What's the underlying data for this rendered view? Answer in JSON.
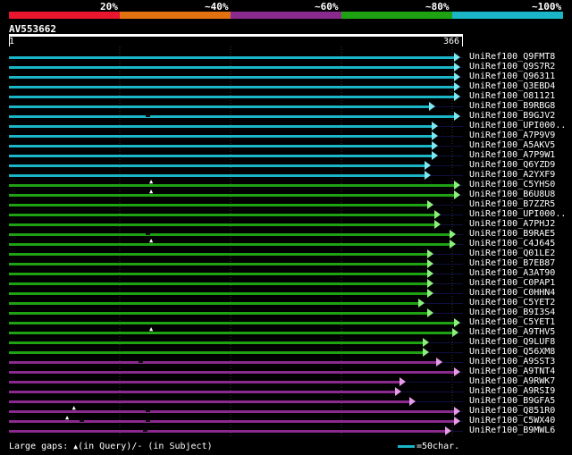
{
  "legend": {
    "labels": [
      "20%",
      "~40%",
      "~60%",
      "~80%",
      "~100%"
    ],
    "colors": [
      "#e8172f",
      "#e27111",
      "#8b2a8e",
      "#1fa114",
      "#1ab5c6"
    ]
  },
  "query": {
    "title": "AV553662",
    "start": "1",
    "end": "366"
  },
  "hits": [
    {
      "name": "UniRef100_Q9FMT8",
      "color": "#1ab5c6",
      "end": 0.985,
      "gaps": []
    },
    {
      "name": "UniRef100_Q9S7R2",
      "color": "#1ab5c6",
      "end": 0.985,
      "gaps": []
    },
    {
      "name": "UniRef100_Q96311",
      "color": "#1ab5c6",
      "end": 0.985,
      "gaps": []
    },
    {
      "name": "UniRef100_Q3EBD4",
      "color": "#1ab5c6",
      "end": 0.985,
      "gaps": []
    },
    {
      "name": "UniRef100_O81121",
      "color": "#1ab5c6",
      "end": 0.985,
      "gaps": []
    },
    {
      "name": "UniRef100_B9RBG8",
      "color": "#1ab5c6",
      "end": 0.93,
      "gaps": []
    },
    {
      "name": "UniRef100_B9GJV2",
      "color": "#1ab5c6",
      "end": 0.985,
      "gaps": [
        {
          "t": "s",
          "p": 0.305
        }
      ]
    },
    {
      "name": "UniRef100_UPI000..",
      "color": "#1ab5c6",
      "end": 0.935,
      "gaps": []
    },
    {
      "name": "UniRef100_A7P9V9",
      "color": "#1ab5c6",
      "end": 0.935,
      "gaps": []
    },
    {
      "name": "UniRef100_A5AKV5",
      "color": "#1ab5c6",
      "end": 0.935,
      "gaps": []
    },
    {
      "name": "UniRef100_A7P9W1",
      "color": "#1ab5c6",
      "end": 0.935,
      "gaps": []
    },
    {
      "name": "UniRef100_Q6YZD9",
      "color": "#1ab5c6",
      "end": 0.92,
      "gaps": []
    },
    {
      "name": "UniRef100_A2YXF9",
      "color": "#1ab5c6",
      "end": 0.92,
      "gaps": []
    },
    {
      "name": "UniRef100_C5YHS0",
      "color": "#1fa114",
      "end": 0.985,
      "gaps": [
        {
          "t": "q",
          "p": 0.315
        }
      ]
    },
    {
      "name": "UniRef100_B6U8U8",
      "color": "#1fa114",
      "end": 0.985,
      "gaps": [
        {
          "t": "q",
          "p": 0.315
        }
      ]
    },
    {
      "name": "UniRef100_B7ZZR5",
      "color": "#1fa114",
      "end": 0.925,
      "gaps": []
    },
    {
      "name": "UniRef100_UPI000..",
      "color": "#1fa114",
      "end": 0.94,
      "gaps": []
    },
    {
      "name": "UniRef100_A7PHJ2",
      "color": "#1fa114",
      "end": 0.94,
      "gaps": []
    },
    {
      "name": "UniRef100_B9RAE5",
      "color": "#1fa114",
      "end": 0.975,
      "gaps": [
        {
          "t": "s",
          "p": 0.305
        }
      ]
    },
    {
      "name": "UniRef100_C4J645",
      "color": "#1fa114",
      "end": 0.975,
      "gaps": [
        {
          "t": "q",
          "p": 0.315
        }
      ]
    },
    {
      "name": "UniRef100_Q01LE2",
      "color": "#1fa114",
      "end": 0.925,
      "gaps": []
    },
    {
      "name": "UniRef100_B7EB87",
      "color": "#1fa114",
      "end": 0.925,
      "gaps": []
    },
    {
      "name": "UniRef100_A3AT90",
      "color": "#1fa114",
      "end": 0.925,
      "gaps": []
    },
    {
      "name": "UniRef100_C0PAP1",
      "color": "#1fa114",
      "end": 0.925,
      "gaps": []
    },
    {
      "name": "UniRef100_C0HHN4",
      "color": "#1fa114",
      "end": 0.925,
      "gaps": []
    },
    {
      "name": "UniRef100_C5YET2",
      "color": "#1fa114",
      "end": 0.905,
      "gaps": []
    },
    {
      "name": "UniRef100_B9I3S4",
      "color": "#1fa114",
      "end": 0.925,
      "gaps": []
    },
    {
      "name": "UniRef100_C5YET1",
      "color": "#1fa114",
      "end": 0.985,
      "gaps": []
    },
    {
      "name": "UniRef100_A9THV5",
      "color": "#1fa114",
      "end": 0.98,
      "gaps": [
        {
          "t": "q",
          "p": 0.315
        }
      ]
    },
    {
      "name": "UniRef100_Q9LUF8",
      "color": "#1fa114",
      "end": 0.915,
      "gaps": []
    },
    {
      "name": "UniRef100_Q56XM8",
      "color": "#1fa114",
      "end": 0.915,
      "gaps": []
    },
    {
      "name": "UniRef100_A9SST3",
      "color": "#8b2a8e",
      "end": 0.945,
      "gaps": [
        {
          "t": "s",
          "p": 0.29
        }
      ]
    },
    {
      "name": "UniRef100_A9TNT4",
      "color": "#8b2a8e",
      "end": 0.985,
      "gaps": []
    },
    {
      "name": "UniRef100_A9RWK7",
      "color": "#8b2a8e",
      "end": 0.865,
      "gaps": []
    },
    {
      "name": "UniRef100_A9RSI9",
      "color": "#8b2a8e",
      "end": 0.855,
      "gaps": []
    },
    {
      "name": "UniRef100_B9GFA5",
      "color": "#8b2a8e",
      "end": 0.885,
      "gaps": []
    },
    {
      "name": "UniRef100_Q851R0",
      "color": "#8b2a8e",
      "end": 0.985,
      "gaps": [
        {
          "t": "q",
          "p": 0.145
        },
        {
          "t": "s",
          "p": 0.305
        }
      ]
    },
    {
      "name": "UniRef100_C5WX40",
      "color": "#8b2a8e",
      "end": 0.985,
      "gaps": [
        {
          "t": "q",
          "p": 0.13
        },
        {
          "t": "s",
          "p": 0.16
        },
        {
          "t": "s",
          "p": 0.305
        }
      ]
    },
    {
      "name": "UniRef100_B9MWL6",
      "color": "#8b2a8e",
      "end": 0.965,
      "gaps": [
        {
          "t": "s",
          "p": 0.3
        }
      ]
    }
  ],
  "footer": {
    "gaps_label": "Large gaps:",
    "gap_query_symbol": "▲",
    "gap_query_text": "(in Query)",
    "gap_subject_text": "/- (in Subject)",
    "scale_text": "=50char."
  }
}
